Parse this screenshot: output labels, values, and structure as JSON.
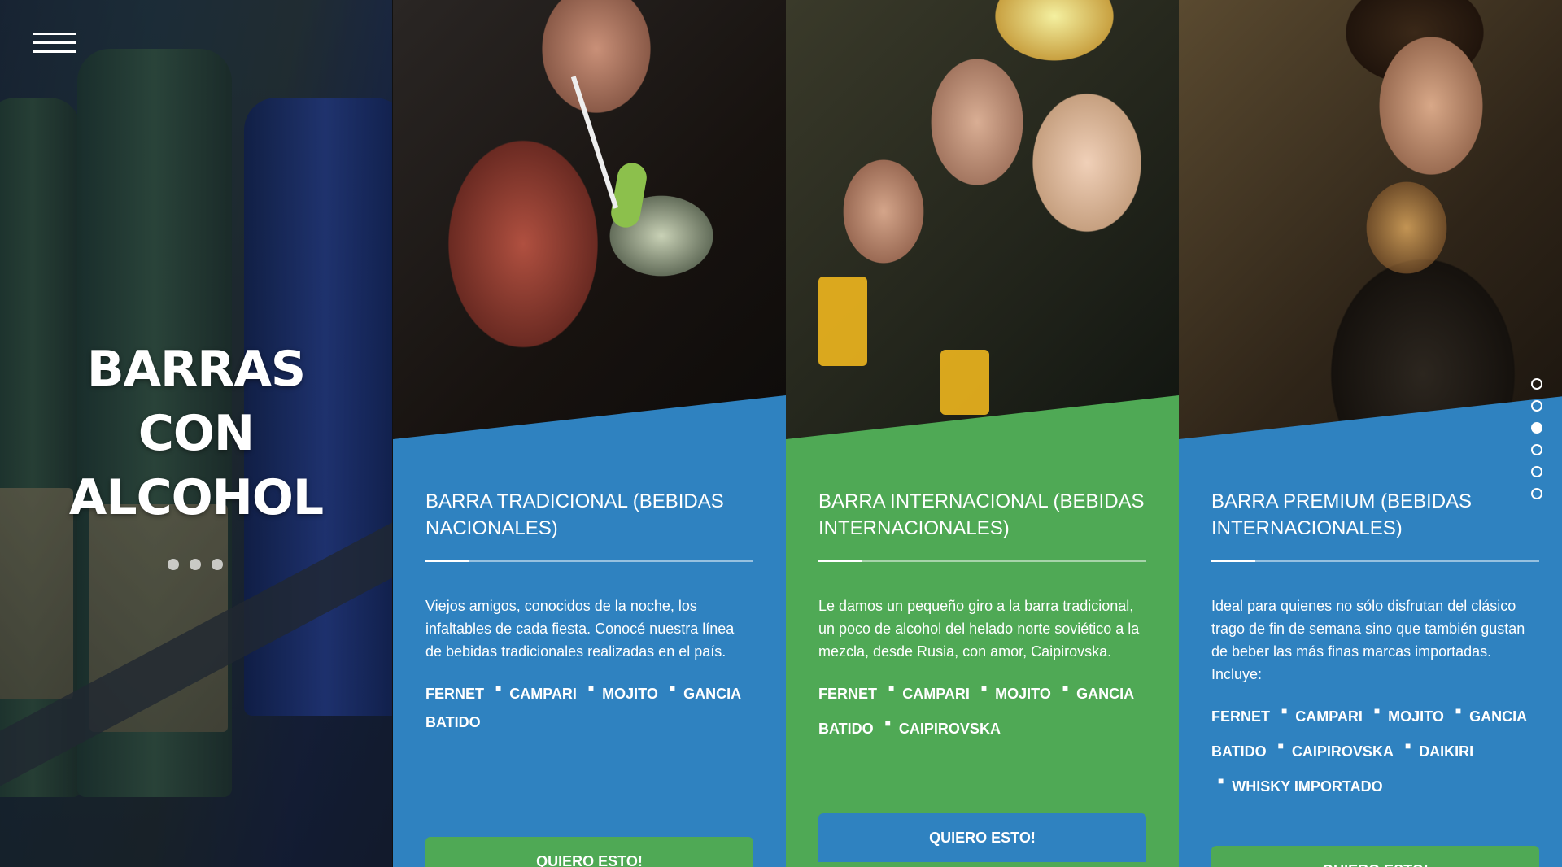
{
  "hero": {
    "title_lines": [
      "BARRAS",
      "CON",
      "ALCOHOL"
    ],
    "dots_count": 3
  },
  "cards": [
    {
      "title": "BARRA TRADICIONAL (BEBIDAS NACIONALES)",
      "description": "Viejos amigos, conocidos de la noche, los infaltables de cada fiesta. Conocé nuestra línea de bebidas tradicionales realizadas en el país.",
      "tags": [
        "FERNET",
        "CAMPARI",
        "MOJITO",
        "GANCIA",
        "BATIDO"
      ],
      "button": "QUIERO ESTO!",
      "panel_color": "#2f82c0",
      "button_color": "#4fa955"
    },
    {
      "title": "BARRA INTERNACIONAL (BEBIDAS INTERNACIONALES)",
      "description": "Le damos un pequeño giro a la barra tradicional, un poco de alcohol del helado norte soviético a la mezcla, desde Rusia, con amor, Caipirovska.",
      "tags": [
        "FERNET",
        "CAMPARI",
        "MOJITO",
        "GANCIA",
        "BATIDO",
        "CAIPIROVSKA"
      ],
      "button": "QUIERO ESTO!",
      "panel_color": "#4fa955",
      "button_color": "#2f82c0"
    },
    {
      "title": "BARRA PREMIUM (BEBIDAS INTERNACIONALES)",
      "description": "Ideal para quienes no sólo disfrutan del clásico trago de fin de semana sino que también gustan de beber las más finas marcas importadas. Incluye:",
      "tags": [
        "FERNET",
        "CAMPARI",
        "MOJITO",
        "GANCIA",
        "BATIDO",
        "CAIPIROVSKA",
        "DAIKIRI",
        "WHISKY IMPORTADO"
      ],
      "button": "QUIERO ESTO!",
      "panel_color": "#2f82c0",
      "button_color": "#4fa955"
    }
  ],
  "pager": {
    "count": 6,
    "active_index": 2
  },
  "colors": {
    "blue": "#2f82c0",
    "green": "#4fa955"
  }
}
